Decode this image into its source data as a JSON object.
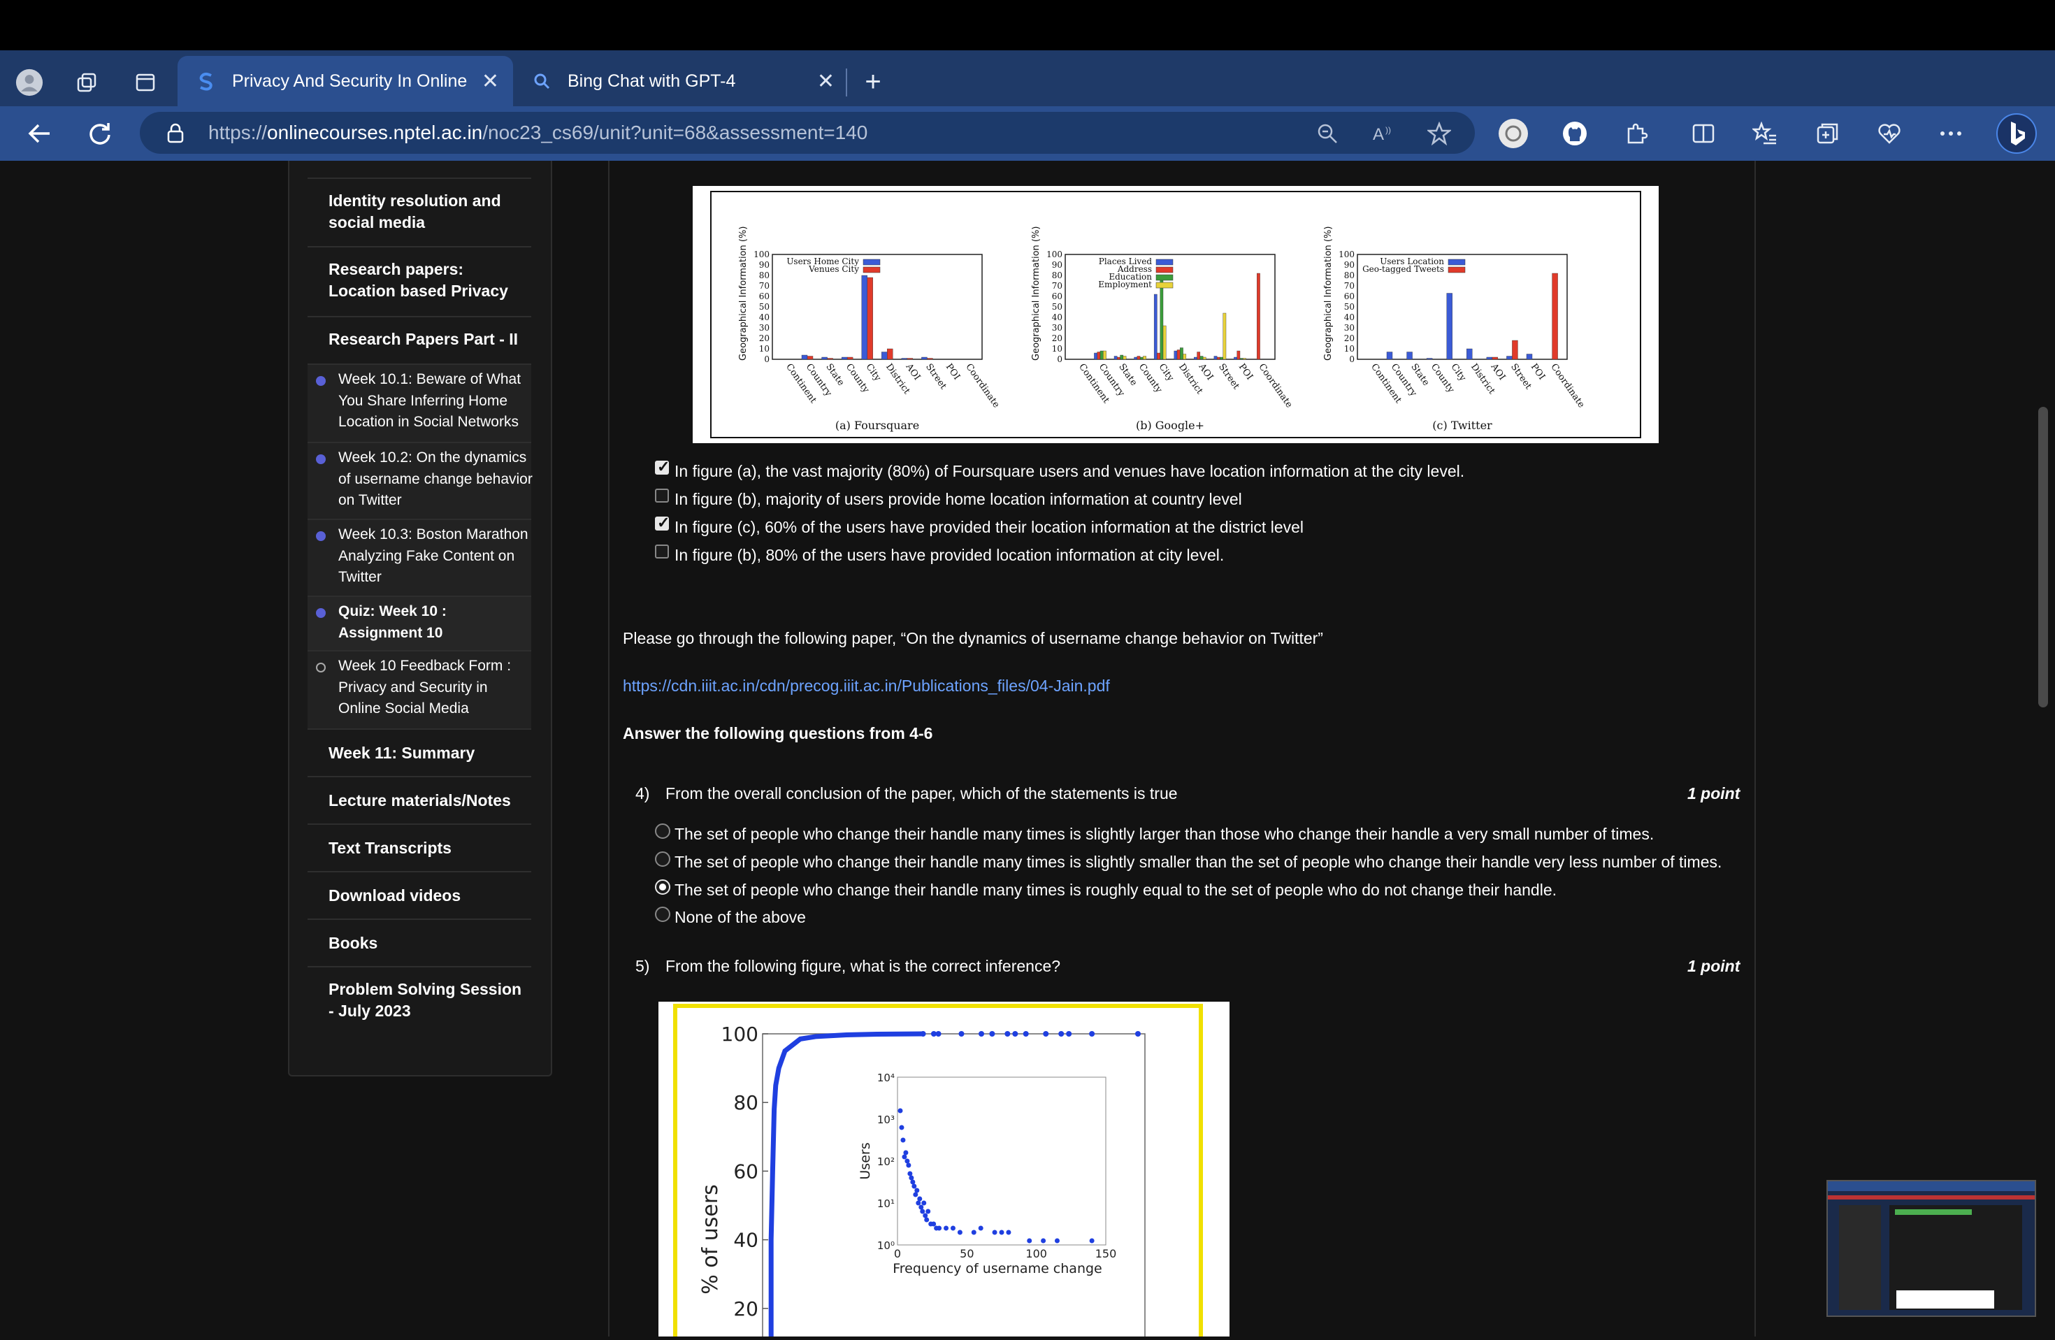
{
  "browser": {
    "tabs": [
      {
        "title": "Privacy And Security In Online",
        "favicon": "s-logo-icon",
        "active": true
      },
      {
        "title": "Bing Chat with GPT-4",
        "favicon": "search-icon",
        "active": false
      }
    ],
    "url_prefix": "https://",
    "url_host": "onlinecourses.nptel.ac.in",
    "url_path": "/noc23_cs69/unit?unit=68&assessment=140",
    "accent": "#2b4f8f"
  },
  "sidebar": {
    "items": [
      {
        "label": "Identity resolution and social media"
      },
      {
        "label": "Research papers: Location based Privacy"
      },
      {
        "label": "Research Papers Part - II"
      },
      {
        "label": "Week 11: Summary"
      },
      {
        "label": "Lecture materials/Notes"
      },
      {
        "label": "Text Transcripts"
      },
      {
        "label": "Download videos"
      },
      {
        "label": "Books"
      },
      {
        "label": "Problem Solving Session - July 2023"
      }
    ],
    "sub_items": [
      {
        "label": "Week 10.1: Beware of What You Share Inferring Home Location in Social Networks",
        "done": true
      },
      {
        "label": "Week 10.2: On the dynamics of username change behavior on Twitter",
        "done": true
      },
      {
        "label": "Week 10.3: Boston Marathon Analyzing Fake Content on Twitter",
        "done": true
      },
      {
        "label": "Quiz: Week 10 : Assignment 10",
        "done": true,
        "bold": true
      },
      {
        "label": "Week 10 Feedback Form : Privacy and Security in Online Social Media",
        "done": false
      }
    ]
  },
  "q3": {
    "options": [
      {
        "text": "In figure (a), the vast majority (80%) of Foursquare users and venues have location information at the city level.",
        "checked": true
      },
      {
        "text": "In figure (b), majority of users provide home location information at country level",
        "checked": false
      },
      {
        "text": "In figure (c), 60% of the users have provided their location information at the district level",
        "checked": true
      },
      {
        "text": "In figure (b), 80% of the users have provided location information at city level.",
        "checked": false
      }
    ]
  },
  "intro": {
    "paper_text": "Please go through the following paper, “On the dynamics of username change behavior on Twitter”",
    "paper_link": "https://cdn.iiit.ac.in/cdn/precog.iiit.ac.in/Publications_files/04-Jain.pdf",
    "answer_heading": "Answer the following questions from 4-6"
  },
  "q4": {
    "number": "4)",
    "text": "From the overall conclusion of the paper, which of the statements is true",
    "points": "1 point",
    "options": [
      {
        "text": "The set of people who change their handle many times is slightly larger than those who change their handle a very small number of times.",
        "selected": false
      },
      {
        "text": "The set of people who change their handle many times is slightly smaller than the set of people who change their handle very less number of times.",
        "selected": false
      },
      {
        "text": "The set of people who change their handle many times is roughly equal to the set of people who do not change their handle.",
        "selected": true
      },
      {
        "text": "None of the above",
        "selected": false
      }
    ]
  },
  "q5": {
    "number": "5)",
    "text": "From the following figure, what is the correct inference?",
    "points": "1 point"
  },
  "chart_data": [
    {
      "type": "bar",
      "subtitle": "(a) Foursquare",
      "ylabel": "Geographical Information (%)",
      "ylim": [
        0,
        100
      ],
      "yticks": [
        "0",
        "10",
        "20",
        "30",
        "40",
        "50",
        "60",
        "70",
        "80",
        "90",
        "100"
      ],
      "categories": [
        "Continent",
        "Country",
        "State",
        "County",
        "City",
        "District",
        "AOI",
        "Street",
        "POI",
        "Coordinate"
      ],
      "series": [
        {
          "name": "Users Home City",
          "color": "#3b5bd6",
          "values": [
            0,
            4,
            2,
            2,
            80,
            7,
            1,
            2,
            0,
            0
          ]
        },
        {
          "name": "Venues City",
          "color": "#e03a2a",
          "values": [
            0,
            3,
            1,
            2,
            78,
            10,
            1,
            1,
            0,
            0
          ]
        }
      ]
    },
    {
      "type": "bar",
      "subtitle": "(b) Google+",
      "ylabel": "Geographical Information (%)",
      "ylim": [
        0,
        100
      ],
      "yticks": [
        "0",
        "10",
        "20",
        "30",
        "40",
        "50",
        "60",
        "70",
        "80",
        "90",
        "100"
      ],
      "categories": [
        "Continent",
        "Country",
        "State",
        "County",
        "City",
        "District",
        "AOI",
        "Street",
        "POI",
        "Coordinate"
      ],
      "series": [
        {
          "name": "Places Lived",
          "color": "#3b5bd6",
          "values": [
            0,
            6,
            3,
            2,
            62,
            8,
            2,
            3,
            2,
            0
          ]
        },
        {
          "name": "Address",
          "color": "#e03a2a",
          "values": [
            0,
            7,
            2,
            3,
            6,
            9,
            7,
            2,
            8,
            82
          ]
        },
        {
          "name": "Education",
          "color": "#3b9c3b",
          "values": [
            0,
            8,
            4,
            2,
            80,
            11,
            3,
            2,
            1,
            0
          ]
        },
        {
          "name": "Employment",
          "color": "#e8d23a",
          "values": [
            0,
            8,
            3,
            3,
            32,
            5,
            2,
            44,
            1,
            0
          ]
        }
      ]
    },
    {
      "type": "bar",
      "subtitle": "(c) Twitter",
      "ylabel": "Geographical Information (%)",
      "ylim": [
        0,
        100
      ],
      "yticks": [
        "0",
        "10",
        "20",
        "30",
        "40",
        "50",
        "60",
        "70",
        "80",
        "90",
        "100"
      ],
      "categories": [
        "Continent",
        "Country",
        "State",
        "County",
        "City",
        "District",
        "AOI",
        "Street",
        "POI",
        "Coordinate"
      ],
      "series": [
        {
          "name": "Users Location",
          "color": "#3b5bd6",
          "values": [
            0,
            7,
            7,
            1,
            63,
            10,
            2,
            3,
            5,
            0
          ]
        },
        {
          "name": "Geo-tagged Tweets",
          "color": "#e03a2a",
          "values": [
            0,
            0,
            0,
            0,
            0,
            0,
            2,
            18,
            0,
            82
          ]
        }
      ]
    },
    {
      "type": "line",
      "ylabel": "% of users",
      "yticks": [
        "20",
        "40",
        "60",
        "80",
        "100"
      ],
      "ylim": [
        0,
        100
      ],
      "main_curve": [
        [
          1,
          0
        ],
        [
          1,
          40
        ],
        [
          2,
          60
        ],
        [
          3,
          78
        ],
        [
          4,
          85
        ],
        [
          6,
          90
        ],
        [
          10,
          95
        ],
        [
          20,
          98.5
        ],
        [
          30,
          99.2
        ],
        [
          50,
          99.7
        ],
        [
          70,
          99.9
        ],
        [
          100,
          100
        ]
      ],
      "outliers_x": [
        100,
        107,
        110,
        125,
        138,
        145,
        155,
        160,
        167,
        180,
        190,
        195,
        210,
        240
      ],
      "inset": {
        "type": "scatter",
        "xlabel": "Frequency of username change",
        "ylabel": "Users",
        "xticks": [
          "0",
          "50",
          "100",
          "150"
        ],
        "yticks": [
          "10⁰",
          "10¹",
          "10²",
          "10³",
          "10⁴"
        ],
        "points": [
          [
            2,
            3.2
          ],
          [
            3,
            2.8
          ],
          [
            4,
            2.5
          ],
          [
            5,
            2.1
          ],
          [
            6,
            2.2
          ],
          [
            7,
            2.0
          ],
          [
            8,
            1.9
          ],
          [
            9,
            1.7
          ],
          [
            10,
            1.6
          ],
          [
            11,
            1.5
          ],
          [
            12,
            1.4
          ],
          [
            13,
            1.2
          ],
          [
            14,
            1.3
          ],
          [
            15,
            1.0
          ],
          [
            16,
            1.1
          ],
          [
            17,
            0.9
          ],
          [
            18,
            0.8
          ],
          [
            19,
            1.0
          ],
          [
            20,
            0.7
          ],
          [
            21,
            0.6
          ],
          [
            22,
            0.8
          ],
          [
            24,
            0.5
          ],
          [
            26,
            0.5
          ],
          [
            28,
            0.4
          ],
          [
            30,
            0.4
          ],
          [
            35,
            0.4
          ],
          [
            40,
            0.4
          ],
          [
            45,
            0.3
          ],
          [
            55,
            0.3
          ],
          [
            60,
            0.4
          ],
          [
            70,
            0.3
          ],
          [
            75,
            0.3
          ],
          [
            80,
            0.3
          ],
          [
            95,
            0.1
          ],
          [
            105,
            0.1
          ],
          [
            115,
            0.1
          ],
          [
            140,
            0.1
          ]
        ]
      }
    }
  ]
}
